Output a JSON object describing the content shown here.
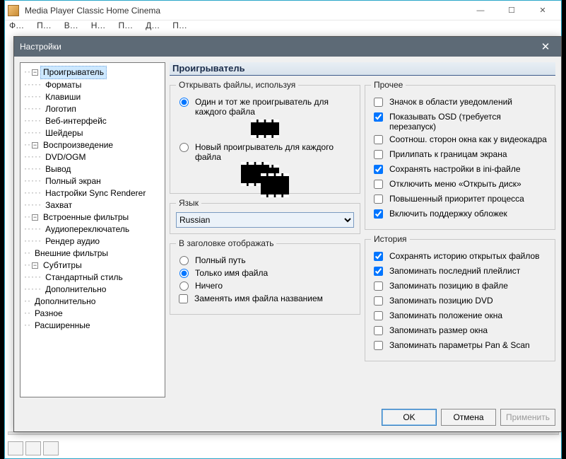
{
  "main": {
    "title": "Media Player Classic Home Cinema",
    "winctl": {
      "min": "—",
      "max": "☐",
      "close": "✕"
    },
    "menubar": [
      "Ф…",
      "П…",
      "В…",
      "Н…",
      "П…",
      "Д…",
      "П…"
    ]
  },
  "dialog": {
    "title": "Настройки",
    "close": "✕",
    "tree": [
      {
        "lvl": 0,
        "tw": "−",
        "label": "Проигрыватель",
        "selected": true
      },
      {
        "lvl": 1,
        "label": "Форматы"
      },
      {
        "lvl": 1,
        "label": "Клавиши"
      },
      {
        "lvl": 1,
        "label": "Логотип"
      },
      {
        "lvl": 1,
        "label": "Веб-интерфейс"
      },
      {
        "lvl": 1,
        "label": "Шейдеры"
      },
      {
        "lvl": 0,
        "tw": "−",
        "label": "Воспроизведение"
      },
      {
        "lvl": 1,
        "label": "DVD/OGM"
      },
      {
        "lvl": 1,
        "label": "Вывод"
      },
      {
        "lvl": 1,
        "label": "Полный экран"
      },
      {
        "lvl": 1,
        "label": "Настройки Sync Renderer"
      },
      {
        "lvl": 1,
        "label": "Захват"
      },
      {
        "lvl": 0,
        "tw": "−",
        "label": "Встроенные фильтры"
      },
      {
        "lvl": 1,
        "label": "Аудиопереключатель"
      },
      {
        "lvl": 1,
        "label": "Рендер аудио"
      },
      {
        "lvl": 0,
        "label": "Внешние фильтры"
      },
      {
        "lvl": 0,
        "tw": "−",
        "label": "Субтитры"
      },
      {
        "lvl": 1,
        "label": "Стандартный стиль"
      },
      {
        "lvl": 1,
        "label": "Дополнительно"
      },
      {
        "lvl": 0,
        "label": "Дополнительно"
      },
      {
        "lvl": 0,
        "label": "Разное"
      },
      {
        "lvl": 0,
        "label": "Расширенные"
      }
    ],
    "panel": {
      "title": "Проигрыватель",
      "open_group": {
        "legend": "Открывать файлы, используя",
        "same": "Один и тот же проигрыватель для каждого файла",
        "new": "Новый проигрыватель для каждого файла"
      },
      "lang_group": {
        "legend": "Язык",
        "value": "Russian"
      },
      "title_group": {
        "legend": "В заголовке отображать",
        "full": "Полный путь",
        "file": "Только имя файла",
        "none": "Ничего",
        "replace": "Заменять имя файла названием"
      },
      "other_group": {
        "legend": "Прочее",
        "items": [
          {
            "label": "Значок в области уведомлений",
            "checked": false
          },
          {
            "label": "Показывать OSD (требуется перезапуск)",
            "checked": true
          },
          {
            "label": "Соотнош. сторон окна как у видеокадра",
            "checked": false
          },
          {
            "label": "Прилипать к границам экрана",
            "checked": false
          },
          {
            "label": "Сохранять настройки в ini-файле",
            "checked": true
          },
          {
            "label": "Отключить меню «Открыть диск»",
            "checked": false
          },
          {
            "label": "Повышенный приоритет процесса",
            "checked": false
          },
          {
            "label": "Включить поддержку обложек",
            "checked": true
          }
        ]
      },
      "history_group": {
        "legend": "История",
        "items": [
          {
            "label": "Сохранять историю открытых файлов",
            "checked": true
          },
          {
            "label": "Запоминать последний плейлист",
            "checked": true
          },
          {
            "label": "Запоминать позицию в файле",
            "checked": false
          },
          {
            "label": "Запоминать позицию DVD",
            "checked": false
          },
          {
            "label": "Запоминать положение окна",
            "checked": false
          },
          {
            "label": "Запоминать размер окна",
            "checked": false
          },
          {
            "label": "Запоминать параметры Pan & Scan",
            "checked": false
          }
        ]
      }
    },
    "buttons": {
      "ok": "OK",
      "cancel": "Отмена",
      "apply": "Применить"
    }
  }
}
